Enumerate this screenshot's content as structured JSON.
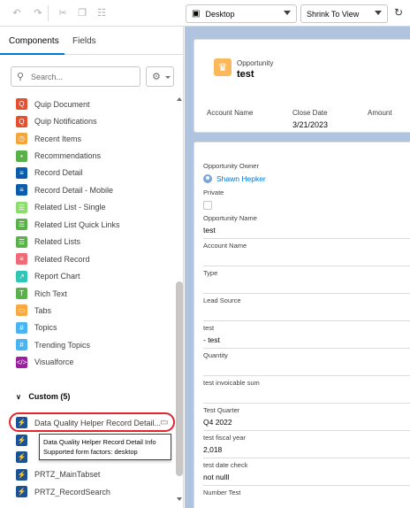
{
  "toolbar": {
    "device_select": "Desktop",
    "view_select": "Shrink To View"
  },
  "left_panel": {
    "tabs": [
      {
        "label": "Components"
      },
      {
        "label": "Fields"
      }
    ],
    "search_placeholder": "Search...",
    "standard_items": [
      {
        "label": "Quip Document",
        "icon": "quip-icon",
        "color": "#e4502f"
      },
      {
        "label": "Quip Notifications",
        "icon": "quip-icon",
        "color": "#e4502f"
      },
      {
        "label": "Recent Items",
        "icon": "clock-icon",
        "color": "#f4a53b"
      },
      {
        "label": "Recommendations",
        "icon": "bulb-icon",
        "color": "#5ab04a"
      },
      {
        "label": "Record Detail",
        "icon": "record-icon",
        "color": "#0b5cab"
      },
      {
        "label": "Record Detail - Mobile",
        "icon": "record-icon",
        "color": "#0b5cab"
      },
      {
        "label": "Related List - Single",
        "icon": "list-icon",
        "color": "#8ddc6e"
      },
      {
        "label": "Related List Quick Links",
        "icon": "list-icon",
        "color": "#5ab04a"
      },
      {
        "label": "Related Lists",
        "icon": "list-icon",
        "color": "#5ab04a"
      },
      {
        "label": "Related Record",
        "icon": "record-icon",
        "color": "#f06a78"
      },
      {
        "label": "Report Chart",
        "icon": "chart-icon",
        "color": "#2dc7b6"
      },
      {
        "label": "Rich Text",
        "icon": "text-icon",
        "color": "#5ab04a"
      },
      {
        "label": "Tabs",
        "icon": "tabs-icon",
        "color": "#f9a93f"
      },
      {
        "label": "Topics",
        "icon": "hash-icon",
        "color": "#4bb4f0"
      },
      {
        "label": "Trending Topics",
        "icon": "hash-icon",
        "color": "#4bb4f0"
      },
      {
        "label": "Visualforce",
        "icon": "code-icon",
        "color": "#9b1fa0"
      }
    ],
    "custom_header": "Custom (5)",
    "custom_items": [
      {
        "label": "Data Quality Helper Record Detail..."
      },
      {
        "label": ""
      },
      {
        "label": ""
      },
      {
        "label": "PRTZ_MainTabset"
      },
      {
        "label": "PRTZ_RecordSearch"
      }
    ],
    "tooltip": {
      "title": "Data Quality Helper Record Detail Info",
      "subtitle": "Supported form factors: desktop"
    }
  },
  "canvas": {
    "record": {
      "object_type": "Opportunity",
      "name": "test",
      "highlights": [
        {
          "label": "Account Name",
          "value": ""
        },
        {
          "label": "Close Date",
          "value": "3/21/2023"
        },
        {
          "label": "Amount",
          "value": ""
        }
      ]
    },
    "fields": {
      "owner_label": "Opportunity Owner",
      "owner_value": "Shawn Hepker",
      "private_label": "Private",
      "name_label": "Opportunity Name",
      "name_value": "test",
      "account_label": "Account Name",
      "type_label": "Type",
      "lead_label": "Lead Source",
      "test_label": "test",
      "test_value": "- test",
      "quantity_label": "Quantity",
      "invoicable_label": "test invoicable sum",
      "quarter_label": "Test Quarter",
      "quarter_value": "Q4 2022",
      "fiscal_label": "test fiscal year",
      "fiscal_value": "2,018",
      "date_check_label": "test date check",
      "date_check_value": "not nulll",
      "number_label": "Number Test"
    }
  }
}
